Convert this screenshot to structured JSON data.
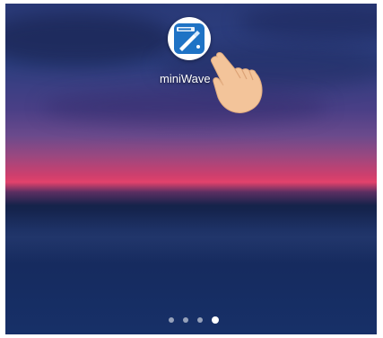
{
  "home_screen": {
    "app": {
      "label": "miniWave",
      "icon": "miniwave-app-icon"
    },
    "gesture_hint": "pointing-hand-icon",
    "page_indicator": {
      "total_pages": 4,
      "current_page": 4
    }
  },
  "colors": {
    "icon_blue": "#1f73c5",
    "horizon_pink": "#e2426c",
    "sky_blue": "#2a3a78",
    "sea_blue": "#173068",
    "hand_skin": "#f3c49a"
  }
}
